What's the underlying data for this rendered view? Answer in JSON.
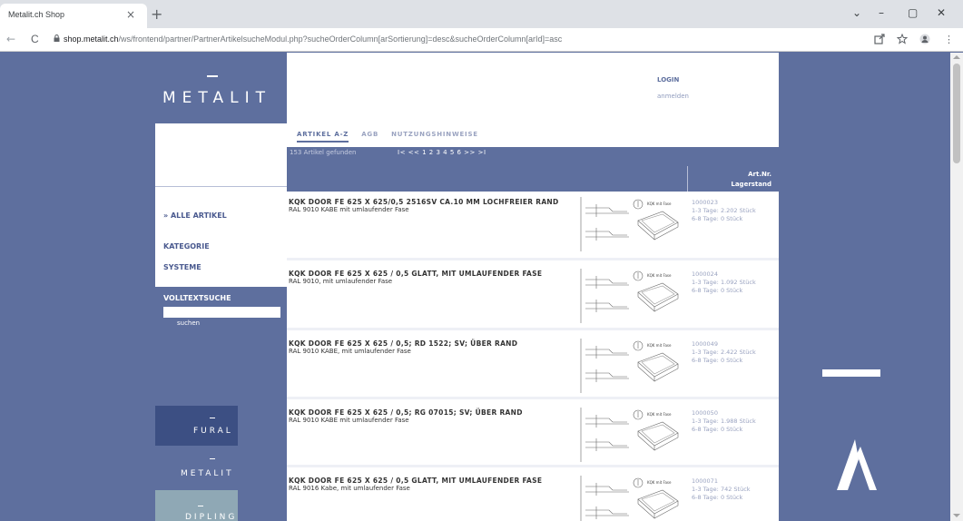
{
  "browser": {
    "tab_title": "Metalit.ch Shop",
    "tab_close": "×",
    "new_tab": "+",
    "url_host": "shop.metalit.ch",
    "url_path": "/ws/frontend/partner/PartnerArtikelsucheModul.php?sucheOrderColumn[arSortierung]=desc&sucheOrderColumn[arId]=asc",
    "back": "←",
    "reload": "C",
    "minimize": "–",
    "maximize": "▢",
    "close": "✕",
    "chevron": "⌄",
    "menu": "⋮"
  },
  "logo": {
    "text": "METALIT"
  },
  "header": {
    "login": "LOGIN",
    "register": "anmelden"
  },
  "topnav": [
    {
      "label": "ARTIKEL A-Z",
      "active": true
    },
    {
      "label": "AGB",
      "active": false
    },
    {
      "label": "NUTZUNGSHINWEISE",
      "active": false
    }
  ],
  "sidebar": {
    "all_items": "» ALLE ARTIKEL",
    "category": "KATEGORIE",
    "systems": "SYSTEME",
    "search_title": "VOLLTEXTSUCHE",
    "search_value": "",
    "search_button": "suchen"
  },
  "brands": {
    "fural": "FURAL",
    "metalit": "METALIT",
    "dipling": "DIPLING"
  },
  "list": {
    "count_text": "153 Artikel gefunden",
    "pager": "I< << 1 2 3 4 5 6 >> >I",
    "col_art": "Art.Nr.",
    "col_stock": "Lagerstand"
  },
  "rows": [
    {
      "title": "KQK DOOR FE 625 X 625/0,5 2516SV CA.10 MM LOCHFREIER RAND",
      "subtitle": "RAL 9010 KABE mit umlaufender Fase",
      "art": "1000023",
      "stock1": "1-3 Tage: 2.202 Stück",
      "stock2": "6-8 Tage: 0 Stück"
    },
    {
      "title": "KQK DOOR FE 625 X 625 / 0,5 GLATT, MIT UMLAUFENDER FASE",
      "subtitle": "RAL 9010, mit umlaufender Fase",
      "art": "1000024",
      "stock1": "1-3 Tage: 1.092 Stück",
      "stock2": "6-8 Tage: 0 Stück"
    },
    {
      "title": "KQK DOOR FE 625 X 625 / 0,5; RD 1522; SV; ÜBER RAND",
      "subtitle": "RAL 9010 KABE, mit umlaufender Fase",
      "art": "1000049",
      "stock1": "1-3 Tage: 2.422 Stück",
      "stock2": "6-8 Tage: 0 Stück"
    },
    {
      "title": "KQK DOOR FE 625 X 625 / 0,5; RG 07015; SV; ÜBER RAND",
      "subtitle": "RAL 9010 KABE mit umlaufender Fase",
      "art": "1000050",
      "stock1": "1-3 Tage: 1.988 Stück",
      "stock2": "6-8 Tage: 0 Stück"
    },
    {
      "title": "KQK DOOR FE 625 X 625 / 0,5 GLATT, MIT UMLAUFENDER FASE",
      "subtitle": "RAL 9016 Kabe, mit umlaufender Fase",
      "art": "1000071",
      "stock1": "1-3 Tage: 742 Stück",
      "stock2": "6-8 Tage: 0 Stück"
    }
  ],
  "diagram_label": "KQK mit Fase",
  "colors": {
    "brand_blue": "#5e6f9e",
    "white": "#ffffff"
  }
}
